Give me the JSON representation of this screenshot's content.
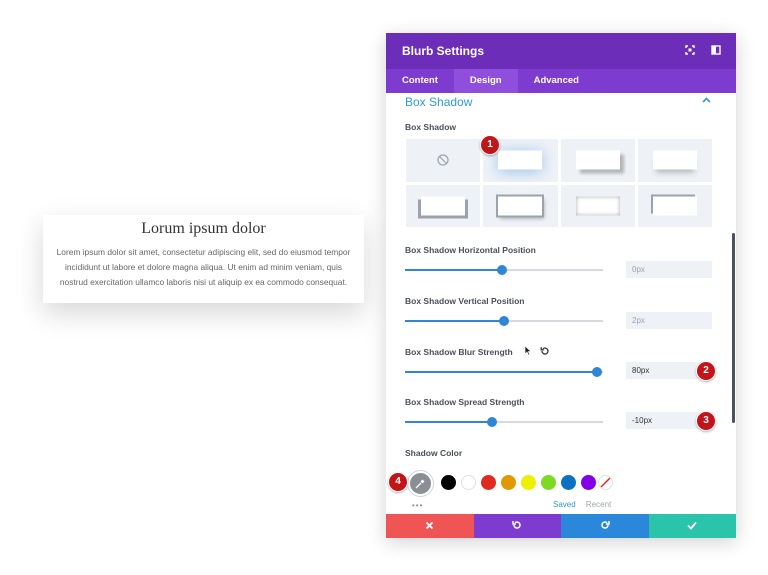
{
  "blurb": {
    "title": "Lorum ipsum dolor",
    "body": "Lorem ipsum dolor sit amet, consectetur adipiscing elit, sed do eiusmod tempor incididunt ut labore et dolore magna aliqua. Ut enim ad minim veniam, quis nostrud exercitation ullamco laboris nisi ut aliquip ex ea commodo consequat."
  },
  "modal": {
    "title": "Blurb Settings",
    "tabs": [
      "Content",
      "Design",
      "Advanced"
    ],
    "active_tab": "Design",
    "section_title": "Box Shadow",
    "box_shadow_label": "Box Shadow",
    "h_pos": {
      "label": "Box Shadow Horizontal Position",
      "value": "0px",
      "percent": 49
    },
    "v_pos": {
      "label": "Box Shadow Vertical Position",
      "value": "2px",
      "percent": 50
    },
    "blur": {
      "label": "Box Shadow Blur Strength",
      "value": "80px",
      "percent": 97
    },
    "spread": {
      "label": "Box Shadow Spread Strength",
      "value": "-10px",
      "percent": 44
    },
    "shadow_color_label": "Shadow Color",
    "saved_label": "Saved",
    "recent_label": "Recent",
    "more_dots": "•••",
    "swatches": [
      "#000000",
      "#ffffff",
      "#e02b20",
      "#e09900",
      "#edf000",
      "#7cda24",
      "#0c71c3",
      "#8300e9"
    ],
    "footer_colors": {
      "cancel": "#ef5555",
      "undo": "#7d3bcf",
      "redo": "#2b87da",
      "save": "#29c4a9"
    }
  },
  "badges": [
    "1",
    "2",
    "3",
    "4"
  ],
  "icons": {
    "no_shadow": "no-shadow-icon",
    "cursor": "cursor-icon",
    "reset": "reset-icon"
  }
}
